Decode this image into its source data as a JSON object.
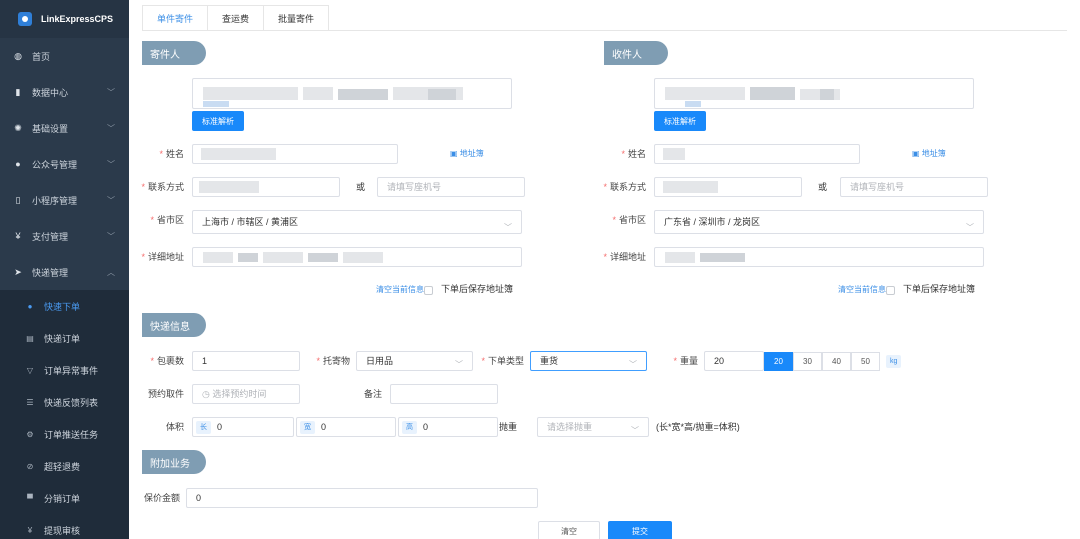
{
  "brand": {
    "title": "LinkExpressCPS"
  },
  "menu": [
    {
      "label": "首页",
      "icon": "dashboard-icon"
    },
    {
      "label": "数据中心",
      "icon": "bar-chart-icon",
      "chevron": "﹀"
    },
    {
      "label": "基础设置",
      "icon": "settings-icon",
      "chevron": "﹀"
    },
    {
      "label": "公众号管理",
      "icon": "wechat-icon",
      "chevron": "﹀"
    },
    {
      "label": "小程序管理",
      "icon": "mobile-icon",
      "chevron": "﹀"
    },
    {
      "label": "支付管理",
      "icon": "yen-icon",
      "chevron": "﹀"
    },
    {
      "label": "快递管理",
      "icon": "send-icon",
      "chevron": "︿"
    }
  ],
  "submenu": [
    {
      "label": "快速下单",
      "active": true
    },
    {
      "label": "快递订单"
    },
    {
      "label": "订单异常事件"
    },
    {
      "label": "快递反馈列表"
    },
    {
      "label": "订单推送任务"
    },
    {
      "label": "超轻退费"
    },
    {
      "label": "分销订单"
    },
    {
      "label": "提现审核"
    }
  ],
  "tabs": [
    "单件寄件",
    "查运费",
    "批量寄件"
  ],
  "sections": {
    "sender": "寄件人",
    "receiver": "收件人",
    "express": "快递信息",
    "extra": "附加业务"
  },
  "common": {
    "parse_btn": "标准解析",
    "name_label": "姓名",
    "address_book": "地址簿",
    "contact_label": "联系方式",
    "or": "或",
    "landline_placeholder": "请填写座机号",
    "region_label": "省市区",
    "detail_label": "详细地址",
    "clear_info": "清空当前信息",
    "save_addr": "下单后保存地址簿"
  },
  "sender": {
    "region": "上海市 / 市辖区 / 黄浦区"
  },
  "receiver": {
    "region": "广东省 / 深圳市 / 龙岗区"
  },
  "express": {
    "packages_label": "包裹数",
    "packages_value": "1",
    "item_label": "托寄物",
    "item_value": "日用品",
    "order_type_label": "下单类型",
    "order_type_value": "重货",
    "weight_label": "重量",
    "weight_value": "20",
    "weight_options": [
      "20",
      "30",
      "40",
      "50"
    ],
    "weight_selected": "20",
    "weight_unit": "kg",
    "pickup_label": "预约取件",
    "pickup_placeholder": "选择预约时间",
    "remark_label": "备注",
    "volume_label": "体积",
    "length_tag": "长",
    "width_tag": "宽",
    "height_tag": "高",
    "length": "0",
    "width": "0",
    "height": "0",
    "throw_label": "抛重",
    "throw_placeholder": "请选择抛重",
    "formula": "(长*宽*高/抛重=体积)"
  },
  "extra": {
    "insured_label": "保价金额",
    "insured_value": "0"
  },
  "actions": {
    "clear": "清空",
    "submit": "提交"
  }
}
